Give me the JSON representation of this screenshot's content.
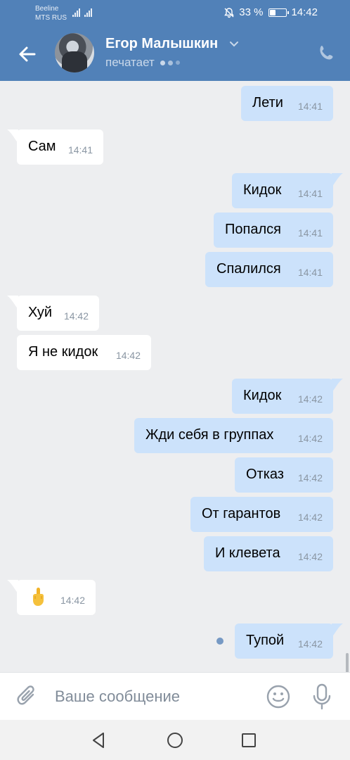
{
  "status_bar": {
    "carrier_line1": "Beeline",
    "carrier_line2": "MTS RUS",
    "battery_percent_text": "33 %",
    "battery_level": 0.33,
    "clock": "14:42"
  },
  "header": {
    "contact_name": "Егор Малышкин",
    "status": "печатает",
    "accent_color": "#5181b8"
  },
  "messages": [
    {
      "direction": "out",
      "text": "Лети",
      "time": "14:41"
    },
    {
      "direction": "in",
      "text": "Сам",
      "time": "14:41"
    },
    {
      "direction": "out",
      "text": "Кидок",
      "time": "14:41"
    },
    {
      "direction": "out",
      "text": "Попался",
      "time": "14:41"
    },
    {
      "direction": "out",
      "text": "Спалился",
      "time": "14:41"
    },
    {
      "direction": "in",
      "text": "Хуй",
      "time": "14:42"
    },
    {
      "direction": "in",
      "text": "Я не кидок",
      "time": "14:42"
    },
    {
      "direction": "out",
      "text": "Кидок",
      "time": "14:42"
    },
    {
      "direction": "out",
      "text": "Жди себя в группах",
      "time": "14:42"
    },
    {
      "direction": "out",
      "text": "Отказ",
      "time": "14:42"
    },
    {
      "direction": "out",
      "text": "От гарантов",
      "time": "14:42"
    },
    {
      "direction": "out",
      "text": "И клевета",
      "time": "14:42"
    },
    {
      "direction": "in",
      "emoji": "middle-finger-emoji",
      "time": "14:42"
    },
    {
      "direction": "out",
      "text": "Тупой",
      "time": "14:42",
      "unread": true
    }
  ],
  "composer": {
    "placeholder": "Ваше сообщение",
    "value": ""
  },
  "icons": {
    "back": "arrow-left-icon",
    "call": "phone-icon",
    "attach": "paperclip-icon",
    "emoji": "smiley-icon",
    "mic": "microphone-icon",
    "nav_back": "triangle-back-icon",
    "nav_home": "circle-home-icon",
    "nav_recent": "square-recent-icon"
  }
}
